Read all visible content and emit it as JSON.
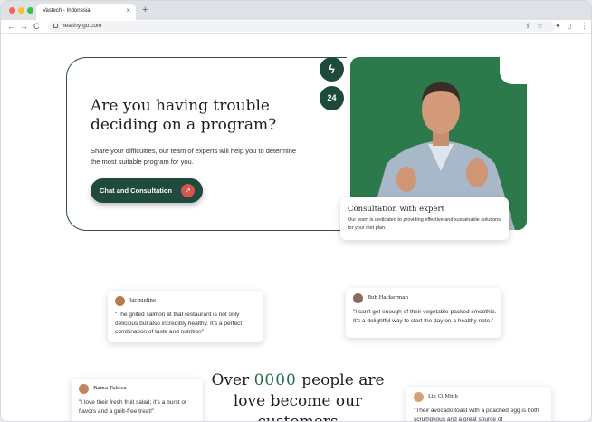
{
  "browser": {
    "tab_title": "Vastech - Indonesia",
    "tab_close": "×",
    "new_tab": "+",
    "back": "←",
    "forward": "→",
    "reload": "C",
    "url": "healthy-go.com",
    "share_icon": "⇪",
    "star_icon": "☆",
    "extensions_icon": "✦",
    "sidepanel_icon": "▯",
    "menu_icon": "⋮"
  },
  "hero": {
    "title": "Are you having trouble deciding on a program?",
    "description": "Share your difficulties, our team of experts will help you to determine the most suitable program for you.",
    "cta_label": "Chat and Consultation",
    "cta_icon": "↗",
    "badge_bolt": "ϟ",
    "badge_24": "24"
  },
  "expert_card": {
    "title": "Consultation with expert",
    "description": "Our team is dedicated to providing effective and sustainable solutions for your diet plan."
  },
  "testimonials": [
    {
      "name": "Jacqueline",
      "quote": "\"The grilled salmon at that restaurant is not only delicious but also incredibly healthy. It's a perfect combination of taste and nutrition\""
    },
    {
      "name": "Bob Hackerman",
      "quote": "\"I can't get enough of their vegetable-packed smoothie. It's a delightful way to start the day on a healthy note.\""
    },
    {
      "name": "Raina Talissa",
      "quote": "\"I love their fresh fruit salad; it's a burst of flavors and a guilt-free treat!\""
    },
    {
      "name": "Liu Ci Minh",
      "quote": "\"Their avocado toast with a poached egg is both scrumptious and a great source of"
    }
  ],
  "stats": {
    "prefix": "Over",
    "counter": "0000",
    "suffix": "people are love become our customers"
  }
}
